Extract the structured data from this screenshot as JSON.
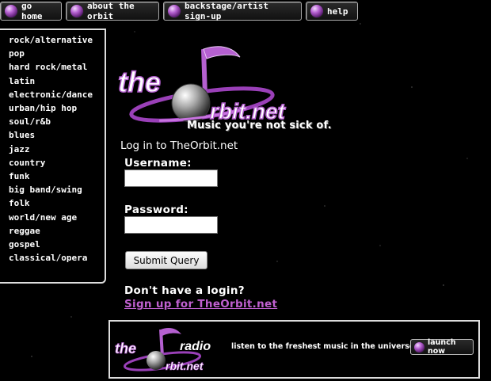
{
  "nav": {
    "items": [
      {
        "label": "go home"
      },
      {
        "label": "about the orbit"
      },
      {
        "label": "backstage/artist sign-up"
      },
      {
        "label": "help"
      }
    ]
  },
  "sidebar": {
    "genres": [
      "rock/alternative",
      "pop",
      "hard rock/metal",
      "latin",
      "electronic/dance",
      "urban/hip hop",
      "soul/r&b",
      "blues",
      "jazz",
      "country",
      "funk",
      "big band/swing",
      "folk",
      "world/new age",
      "reggae",
      "gospel",
      "classical/opera"
    ]
  },
  "logo": {
    "text_the": "the",
    "text_orbit": "rbit.net",
    "tagline": "Music you're not sick of."
  },
  "login": {
    "title": "Log in to TheOrbit.net",
    "username_label": "Username:",
    "username_value": "",
    "password_label": "Password:",
    "password_value": "",
    "submit_label": "Submit Query",
    "no_login": "Don't have a login?",
    "signup_link": "Sign up for TheOrbit.net"
  },
  "radio": {
    "logo_the": "the",
    "logo_radio": "radio",
    "logo_orbit": "rbit.net",
    "text": "listen to the freshest music in the universe",
    "launch_label": "launch now"
  },
  "colors": {
    "accent_purple": "#b560d0",
    "link": "#c060d0"
  }
}
